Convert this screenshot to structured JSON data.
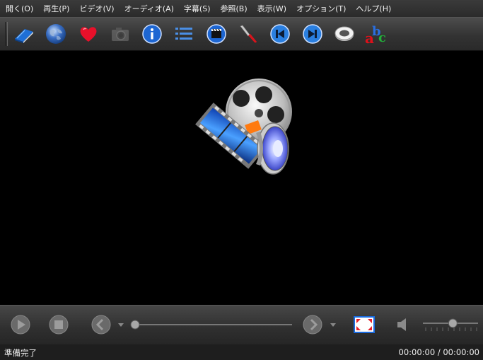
{
  "menu": [
    "開く(O)",
    "再生(P)",
    "ビデオ(V)",
    "オーディオ(A)",
    "字幕(S)",
    "参照(B)",
    "表示(W)",
    "オプション(T)",
    "ヘルプ(H)"
  ],
  "toolbar": {
    "icons": [
      "open-file-icon",
      "open-url-icon",
      "favorites-icon",
      "screenshot-icon",
      "info-icon",
      "playlist-icon",
      "video-equalizer-icon",
      "preferences-icon",
      "previous-icon",
      "next-icon",
      "audio-icon",
      "subtitles-icon"
    ],
    "subtitles_glyph_a": "a",
    "subtitles_glyph_b": "b",
    "subtitles_glyph_c": "c"
  },
  "controls": {
    "seek_position": 0.0,
    "volume_level": 0.55
  },
  "status": {
    "left": "準備完了",
    "right": "00:00:00 / 00:00:00"
  },
  "colors": {
    "menubar": "#2f2f2f",
    "toolbar": "#3a3a3a",
    "video_background": "#000000",
    "accent_blue": "#2a7fe0"
  }
}
